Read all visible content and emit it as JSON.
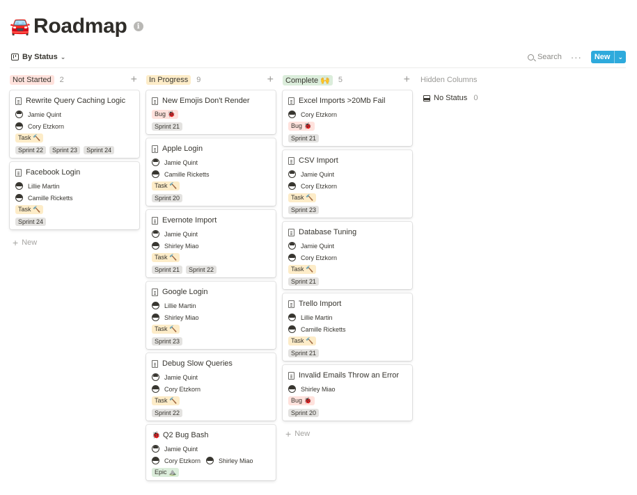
{
  "page": {
    "emoji": "🚘",
    "title": "Roadmap",
    "info_icon": "info-icon"
  },
  "toolbar": {
    "view_label": "By Status",
    "search_label": "Search",
    "more_label": "···",
    "new_label": "New"
  },
  "colors": {
    "not_started": "#ffe2dd",
    "in_progress": "#fdecc8",
    "complete": "#dbeddb",
    "task": "#fdecc8",
    "bug": "#ffe2dd",
    "epic": "#dbeddb",
    "sprint": "#e3e2e0",
    "new_button": "#2eaadc"
  },
  "columns": [
    {
      "name": "Not Started",
      "count": "2",
      "new_label": "New",
      "cards": [
        {
          "icon": "page",
          "title": "Rewrite Query Caching Logic",
          "rows": [
            {
              "type": "people",
              "people": [
                "Jamie Quint"
              ]
            },
            {
              "type": "people",
              "people": [
                "Cory Etzkorn"
              ]
            },
            {
              "type": "tags",
              "tags": [
                {
                  "kind": "task",
                  "label": "Task 🔨"
                }
              ]
            },
            {
              "type": "tags",
              "tags": [
                {
                  "kind": "sprint",
                  "label": "Sprint 22"
                },
                {
                  "kind": "sprint",
                  "label": "Sprint 23"
                },
                {
                  "kind": "sprint",
                  "label": "Sprint 24"
                }
              ]
            }
          ]
        },
        {
          "icon": "page",
          "title": "Facebook Login",
          "rows": [
            {
              "type": "people",
              "people": [
                "Lillie Martin"
              ]
            },
            {
              "type": "people",
              "people": [
                "Camille Ricketts"
              ]
            },
            {
              "type": "tags",
              "tags": [
                {
                  "kind": "task",
                  "label": "Task 🔨"
                }
              ]
            },
            {
              "type": "tags",
              "tags": [
                {
                  "kind": "sprint",
                  "label": "Sprint 24"
                }
              ]
            }
          ]
        }
      ]
    },
    {
      "name": "In Progress",
      "count": "9",
      "new_label": "",
      "cards": [
        {
          "icon": "page",
          "title": "New Emojis Don't Render",
          "rows": [
            {
              "type": "tags",
              "tags": [
                {
                  "kind": "bug",
                  "label": "Bug 🐞"
                }
              ]
            },
            {
              "type": "tags",
              "tags": [
                {
                  "kind": "sprint",
                  "label": "Sprint 21"
                }
              ]
            }
          ]
        },
        {
          "icon": "page",
          "title": "Apple Login",
          "rows": [
            {
              "type": "people",
              "people": [
                "Jamie Quint"
              ]
            },
            {
              "type": "people",
              "people": [
                "Camille Ricketts"
              ]
            },
            {
              "type": "tags",
              "tags": [
                {
                  "kind": "task",
                  "label": "Task 🔨"
                }
              ]
            },
            {
              "type": "tags",
              "tags": [
                {
                  "kind": "sprint",
                  "label": "Sprint 20"
                }
              ]
            }
          ]
        },
        {
          "icon": "page",
          "title": "Evernote Import",
          "rows": [
            {
              "type": "people",
              "people": [
                "Jamie Quint"
              ]
            },
            {
              "type": "people",
              "people": [
                "Shirley Miao"
              ]
            },
            {
              "type": "tags",
              "tags": [
                {
                  "kind": "task",
                  "label": "Task 🔨"
                }
              ]
            },
            {
              "type": "tags",
              "tags": [
                {
                  "kind": "sprint",
                  "label": "Sprint 21"
                },
                {
                  "kind": "sprint",
                  "label": "Sprint 22"
                }
              ]
            }
          ]
        },
        {
          "icon": "page",
          "title": "Google Login",
          "rows": [
            {
              "type": "people",
              "people": [
                "Lillie Martin"
              ]
            },
            {
              "type": "people",
              "people": [
                "Shirley Miao"
              ]
            },
            {
              "type": "tags",
              "tags": [
                {
                  "kind": "task",
                  "label": "Task 🔨"
                }
              ]
            },
            {
              "type": "tags",
              "tags": [
                {
                  "kind": "sprint",
                  "label": "Sprint 23"
                }
              ]
            }
          ]
        },
        {
          "icon": "page",
          "title": "Debug Slow Queries",
          "rows": [
            {
              "type": "people",
              "people": [
                "Jamie Quint"
              ]
            },
            {
              "type": "people",
              "people": [
                "Cory Etzkorn"
              ]
            },
            {
              "type": "tags",
              "tags": [
                {
                  "kind": "task",
                  "label": "Task 🔨"
                }
              ]
            },
            {
              "type": "tags",
              "tags": [
                {
                  "kind": "sprint",
                  "label": "Sprint 22"
                }
              ]
            }
          ]
        },
        {
          "icon": "bug",
          "emoji": "🐞",
          "title": "Q2 Bug Bash",
          "rows": [
            {
              "type": "people",
              "people": [
                "Jamie Quint"
              ]
            },
            {
              "type": "people",
              "people": [
                "Cory Etzkorn",
                "Shirley Miao"
              ]
            },
            {
              "type": "tags",
              "tags": [
                {
                  "kind": "epic",
                  "label": "Epic ⛰️"
                }
              ]
            }
          ]
        }
      ]
    },
    {
      "name": "Complete 🙌",
      "count": "5",
      "new_label": "New",
      "cards": [
        {
          "icon": "page",
          "title": "Excel Imports >20Mb Fail",
          "rows": [
            {
              "type": "people",
              "people": [
                "Cory Etzkorn"
              ]
            },
            {
              "type": "tags",
              "tags": [
                {
                  "kind": "bug",
                  "label": "Bug 🐞"
                }
              ]
            },
            {
              "type": "tags",
              "tags": [
                {
                  "kind": "sprint",
                  "label": "Sprint 21"
                }
              ]
            }
          ]
        },
        {
          "icon": "page",
          "title": "CSV Import",
          "rows": [
            {
              "type": "people",
              "people": [
                "Jamie Quint"
              ]
            },
            {
              "type": "people",
              "people": [
                "Cory Etzkorn"
              ]
            },
            {
              "type": "tags",
              "tags": [
                {
                  "kind": "task",
                  "label": "Task 🔨"
                }
              ]
            },
            {
              "type": "tags",
              "tags": [
                {
                  "kind": "sprint",
                  "label": "Sprint 23"
                }
              ]
            }
          ]
        },
        {
          "icon": "page",
          "title": "Database Tuning",
          "rows": [
            {
              "type": "people",
              "people": [
                "Jamie Quint"
              ]
            },
            {
              "type": "people",
              "people": [
                "Cory Etzkorn"
              ]
            },
            {
              "type": "tags",
              "tags": [
                {
                  "kind": "task",
                  "label": "Task 🔨"
                }
              ]
            },
            {
              "type": "tags",
              "tags": [
                {
                  "kind": "sprint",
                  "label": "Sprint 21"
                }
              ]
            }
          ]
        },
        {
          "icon": "page",
          "title": "Trello Import",
          "rows": [
            {
              "type": "people",
              "people": [
                "Lillie Martin"
              ]
            },
            {
              "type": "people",
              "people": [
                "Camille Ricketts"
              ]
            },
            {
              "type": "tags",
              "tags": [
                {
                  "kind": "task",
                  "label": "Task 🔨"
                }
              ]
            },
            {
              "type": "tags",
              "tags": [
                {
                  "kind": "sprint",
                  "label": "Sprint 21"
                }
              ]
            }
          ]
        },
        {
          "icon": "page",
          "title": "Invalid Emails Throw an Error",
          "rows": [
            {
              "type": "people",
              "people": [
                "Shirley Miao"
              ]
            },
            {
              "type": "tags",
              "tags": [
                {
                  "kind": "bug",
                  "label": "Bug 🐞"
                }
              ]
            },
            {
              "type": "tags",
              "tags": [
                {
                  "kind": "sprint",
                  "label": "Sprint 20"
                }
              ]
            }
          ]
        }
      ]
    }
  ],
  "hidden_columns": {
    "title": "Hidden Columns",
    "items": [
      {
        "name": "No Status",
        "count": "0"
      }
    ]
  }
}
